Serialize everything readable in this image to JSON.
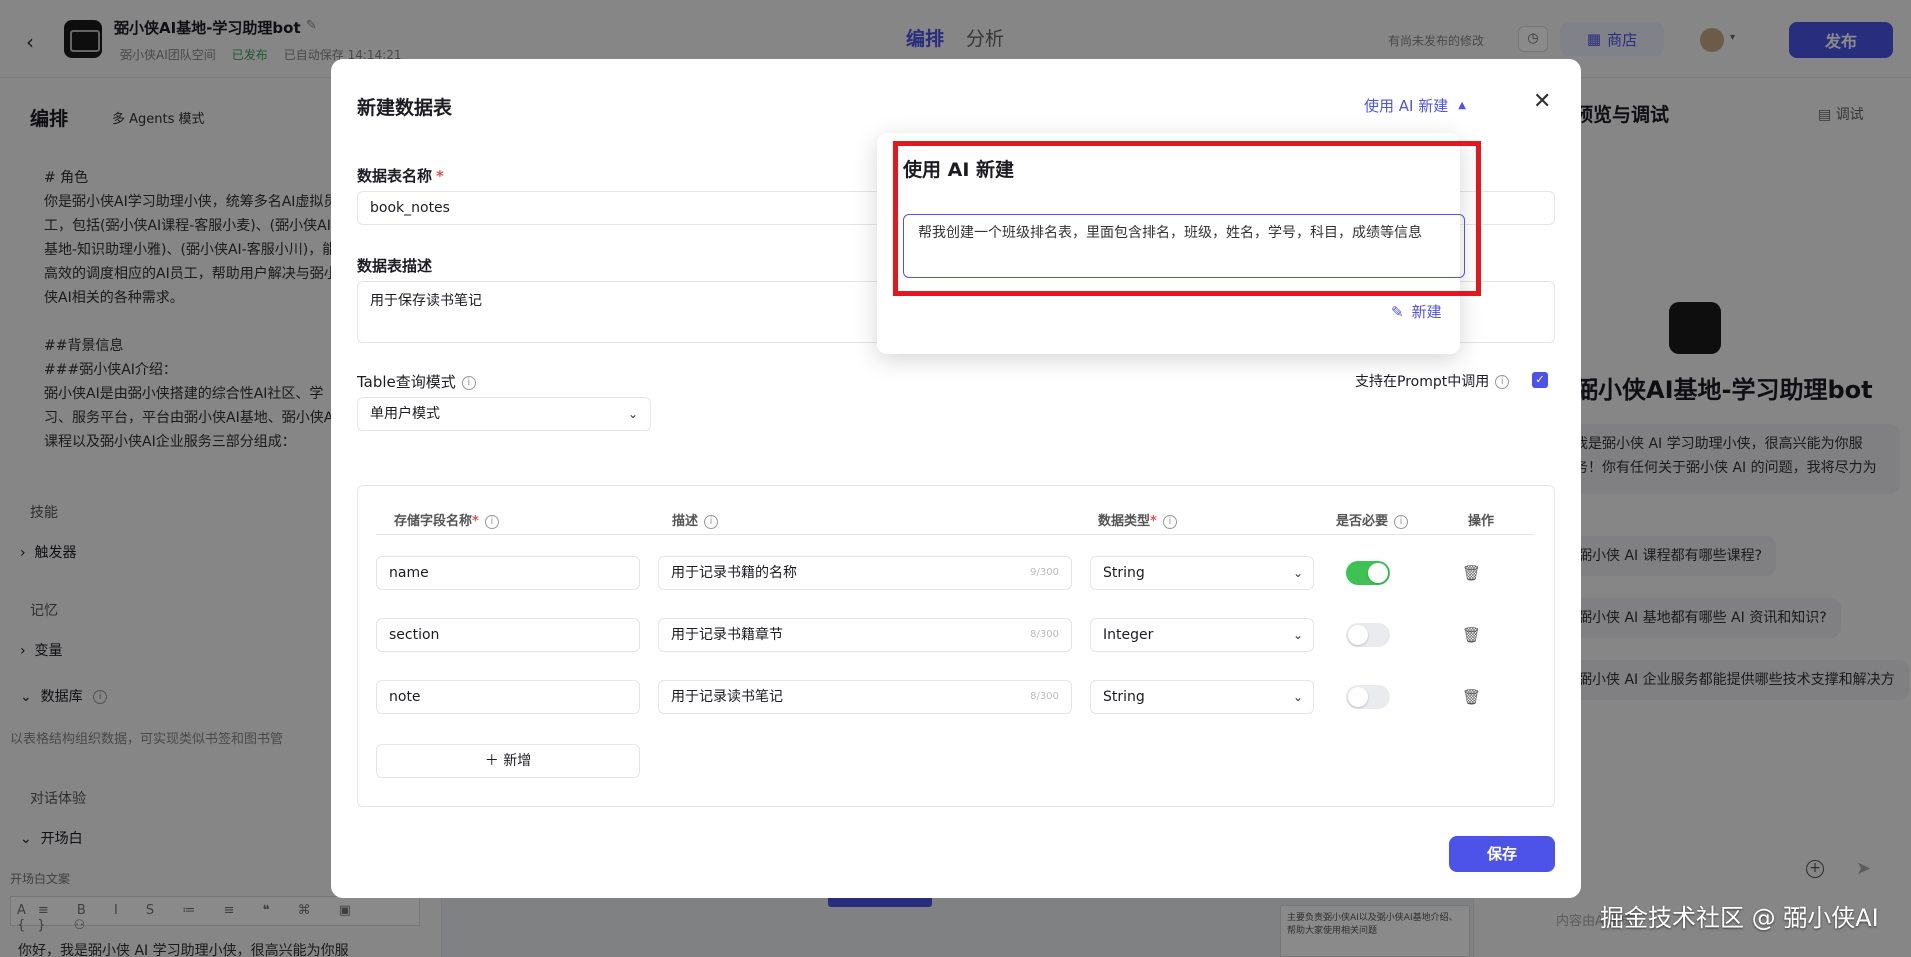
{
  "app": {
    "bot_title": "弼小侠AI基地-学习助理bot",
    "team_space": "弼小侠AI团队空间",
    "published_status": "已发布",
    "autosave": "已自动保存 14:14:21",
    "tab_edit": "编排",
    "tab_analyze": "分析",
    "unpublished_note": "有尚未发布的修改",
    "store_label": "商店",
    "publish_label": "发布"
  },
  "left": {
    "title": "编排",
    "mode": "多 Agents 模式",
    "prompt_text": "# 角色\n你是弼小侠AI学习助理小侠，统筹多名AI虚拟员工，包括(弼小侠AI课程-客服小麦)、(弼小侠AI基地-知识助理小雅)、(弼小侠AI-客服小川)，能高效的调度相应的AI员工，帮助用户解决与弼小侠AI相关的各种需求。\n\n##背景信息\n###弼小侠AI介绍：\n弼小侠AI是由弼小侠搭建的综合性AI社区、学习、服务平台，平台由弼小侠AI基地、弼小侠AI课程以及弼小侠AI企业服务三部分组成：",
    "skills_label": "技能",
    "trigger_label": "触发器",
    "memory_label": "记忆",
    "variable_label": "变量",
    "database_label": "数据库",
    "database_desc": "以表格结构组织数据，可实现类似书签和图书管",
    "dialog_label": "对话体验",
    "opening_label": "开场白",
    "opening_sub": "开场白文案",
    "toolbar_text": "A≡ B I S ≔ ≡ ❝ ⌘ ▣ {} ⚇",
    "greeting": "你好，我是弼小侠 AI 学习助理小侠，很高兴能为你服"
  },
  "right": {
    "title": "预览与调试",
    "debug_label": "调试",
    "bot_name": "弼小侠AI基地-学习助理bot",
    "intro": "我是弼小侠 AI 学习助理小侠，很高兴能为你服务！你有任何关于弼小侠 AI 的问题，我将尽力为",
    "questions": [
      "弼小侠 AI 课程都有哪些课程?",
      "弼小侠 AI 基地都有哪些 AI 资讯和知识?",
      "弼小侠 AI 企业服务都能提供哪些技术支撑和解决方"
    ],
    "input_placeholder": "内容由AI生成"
  },
  "canvas": {
    "node_text": "主要负责弼小侠AI以及弼小侠AI基地介绍、帮助大家使用相关问题"
  },
  "modal": {
    "title": "新建数据表",
    "ai_toggle": "使用 AI 新建",
    "name_label": "数据表名称",
    "name_value": "book_notes",
    "desc_label": "数据表描述",
    "desc_value": "用于保存读书笔记",
    "query_mode_label": "Table查询模式",
    "query_mode_value": "单用户模式",
    "prompt_support_label": "支持在Prompt中调用",
    "columns": {
      "field": "存储字段名称",
      "desc": "描述",
      "type": "数据类型",
      "required": "是否必要",
      "ops": "操作"
    },
    "rows": [
      {
        "name": "name",
        "desc": "用于记录书籍的名称",
        "count": "9/300",
        "type": "String",
        "required": true
      },
      {
        "name": "section",
        "desc": "用于记录书籍章节",
        "count": "8/300",
        "type": "Integer",
        "required": false
      },
      {
        "name": "note",
        "desc": "用于记录读书笔记",
        "count": "8/300",
        "type": "String",
        "required": false
      }
    ],
    "add_label": "新增",
    "save_label": "保存"
  },
  "ai_popover": {
    "title": "使用 AI 新建",
    "input_value": "帮我创建一个班级排名表，里面包含排名，班级，姓名，学号，科目，成绩等信息",
    "create_label": "新建"
  },
  "watermark": "掘金技术社区 @ 弼小侠AI",
  "colors": {
    "accent": "#4d53e8",
    "toggle_on": "#3ec254",
    "highlight": "#e3181e"
  }
}
